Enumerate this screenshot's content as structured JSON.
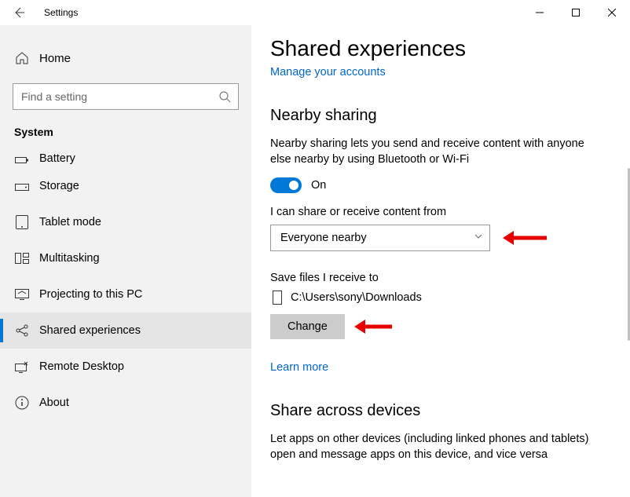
{
  "titlebar": {
    "title": "Settings"
  },
  "sidebar": {
    "home_label": "Home",
    "search_placeholder": "Find a setting",
    "section": "System",
    "items": [
      {
        "label": "Battery",
        "icon": "battery"
      },
      {
        "label": "Storage",
        "icon": "storage"
      },
      {
        "label": "Tablet mode",
        "icon": "tablet"
      },
      {
        "label": "Multitasking",
        "icon": "multitask"
      },
      {
        "label": "Projecting to this PC",
        "icon": "project"
      },
      {
        "label": "Shared experiences",
        "icon": "share"
      },
      {
        "label": "Remote Desktop",
        "icon": "remote"
      },
      {
        "label": "About",
        "icon": "about"
      }
    ]
  },
  "main": {
    "title": "Shared experiences",
    "manage_link": "Manage your accounts",
    "nearby": {
      "heading": "Nearby sharing",
      "description": "Nearby sharing lets you send and receive content with anyone else nearby by using Bluetooth or Wi-Fi",
      "toggle_state": "On",
      "toggle_on": true,
      "share_from_label": "I can share or receive content from",
      "share_from_value": "Everyone nearby",
      "save_to_label": "Save files I receive to",
      "save_to_path": "C:\\Users\\sony\\Downloads",
      "change_button": "Change",
      "learn_more": "Learn more"
    },
    "share_across": {
      "heading": "Share across devices",
      "description": "Let apps on other devices (including linked phones and tablets) open and message apps on this device, and vice versa"
    }
  }
}
